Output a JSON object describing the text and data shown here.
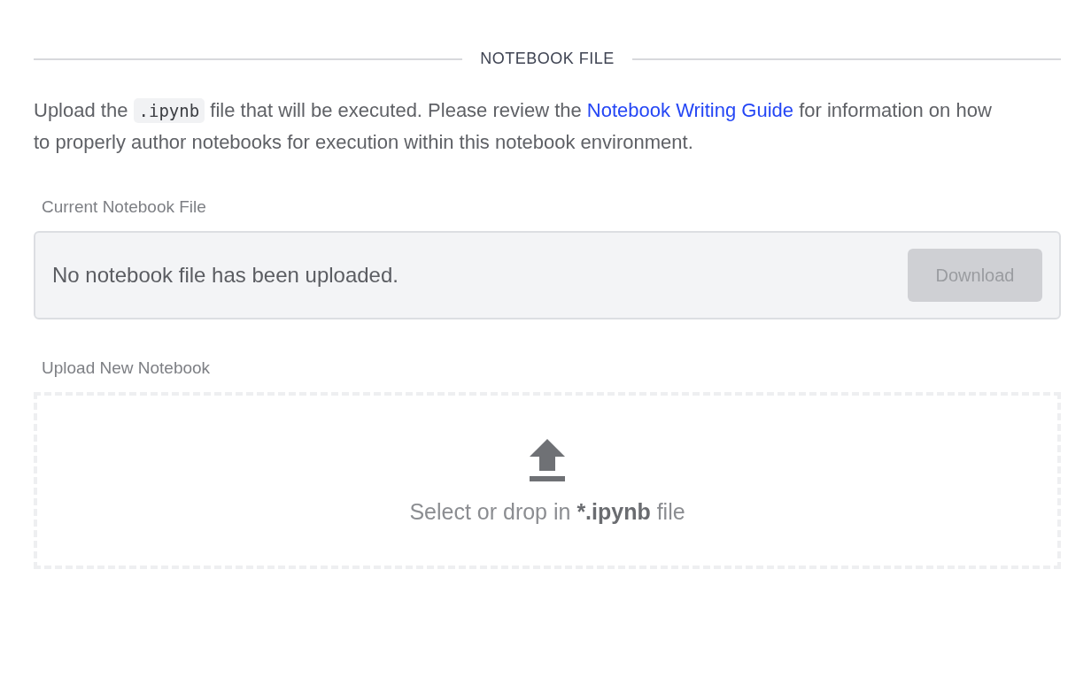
{
  "section": {
    "title": "NOTEBOOK FILE"
  },
  "description": {
    "before": "Upload the ",
    "code": ".ipynb",
    "middle": " file that will be executed. Please review the ",
    "link": "Notebook Writing Guide",
    "after": " for information on how to properly author notebooks for execution within this notebook environment."
  },
  "current_file": {
    "label": "Current Notebook File",
    "message": "No notebook file has been uploaded.",
    "download": {
      "label": "Download",
      "disabled": true
    }
  },
  "upload": {
    "label": "Upload New Notebook",
    "prompt": [
      {
        "text": "Select or drop in ",
        "bold": false
      },
      {
        "text": "*.ipynb",
        "bold": true
      },
      {
        "text": " file",
        "bold": false
      }
    ]
  }
}
